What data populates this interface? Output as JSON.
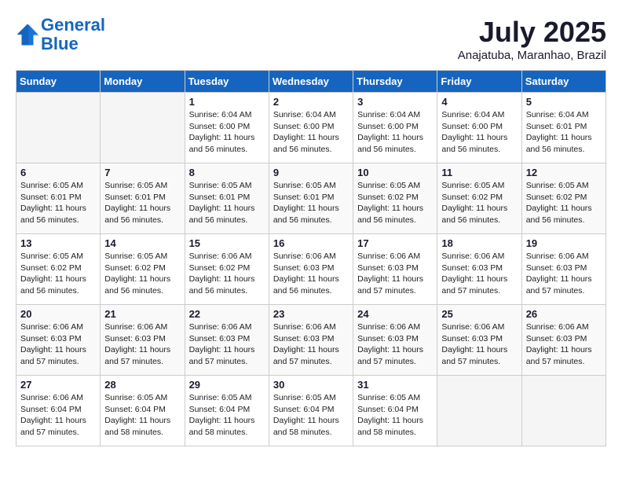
{
  "header": {
    "logo_line1": "General",
    "logo_line2": "Blue",
    "month_title": "July 2025",
    "location": "Anajatuba, Maranhao, Brazil"
  },
  "weekdays": [
    "Sunday",
    "Monday",
    "Tuesday",
    "Wednesday",
    "Thursday",
    "Friday",
    "Saturday"
  ],
  "weeks": [
    [
      {
        "day": "",
        "info": ""
      },
      {
        "day": "",
        "info": ""
      },
      {
        "day": "1",
        "info": "Sunrise: 6:04 AM\nSunset: 6:00 PM\nDaylight: 11 hours and 56 minutes."
      },
      {
        "day": "2",
        "info": "Sunrise: 6:04 AM\nSunset: 6:00 PM\nDaylight: 11 hours and 56 minutes."
      },
      {
        "day": "3",
        "info": "Sunrise: 6:04 AM\nSunset: 6:00 PM\nDaylight: 11 hours and 56 minutes."
      },
      {
        "day": "4",
        "info": "Sunrise: 6:04 AM\nSunset: 6:00 PM\nDaylight: 11 hours and 56 minutes."
      },
      {
        "day": "5",
        "info": "Sunrise: 6:04 AM\nSunset: 6:01 PM\nDaylight: 11 hours and 56 minutes."
      }
    ],
    [
      {
        "day": "6",
        "info": "Sunrise: 6:05 AM\nSunset: 6:01 PM\nDaylight: 11 hours and 56 minutes."
      },
      {
        "day": "7",
        "info": "Sunrise: 6:05 AM\nSunset: 6:01 PM\nDaylight: 11 hours and 56 minutes."
      },
      {
        "day": "8",
        "info": "Sunrise: 6:05 AM\nSunset: 6:01 PM\nDaylight: 11 hours and 56 minutes."
      },
      {
        "day": "9",
        "info": "Sunrise: 6:05 AM\nSunset: 6:01 PM\nDaylight: 11 hours and 56 minutes."
      },
      {
        "day": "10",
        "info": "Sunrise: 6:05 AM\nSunset: 6:02 PM\nDaylight: 11 hours and 56 minutes."
      },
      {
        "day": "11",
        "info": "Sunrise: 6:05 AM\nSunset: 6:02 PM\nDaylight: 11 hours and 56 minutes."
      },
      {
        "day": "12",
        "info": "Sunrise: 6:05 AM\nSunset: 6:02 PM\nDaylight: 11 hours and 56 minutes."
      }
    ],
    [
      {
        "day": "13",
        "info": "Sunrise: 6:05 AM\nSunset: 6:02 PM\nDaylight: 11 hours and 56 minutes."
      },
      {
        "day": "14",
        "info": "Sunrise: 6:05 AM\nSunset: 6:02 PM\nDaylight: 11 hours and 56 minutes."
      },
      {
        "day": "15",
        "info": "Sunrise: 6:06 AM\nSunset: 6:02 PM\nDaylight: 11 hours and 56 minutes."
      },
      {
        "day": "16",
        "info": "Sunrise: 6:06 AM\nSunset: 6:03 PM\nDaylight: 11 hours and 56 minutes."
      },
      {
        "day": "17",
        "info": "Sunrise: 6:06 AM\nSunset: 6:03 PM\nDaylight: 11 hours and 57 minutes."
      },
      {
        "day": "18",
        "info": "Sunrise: 6:06 AM\nSunset: 6:03 PM\nDaylight: 11 hours and 57 minutes."
      },
      {
        "day": "19",
        "info": "Sunrise: 6:06 AM\nSunset: 6:03 PM\nDaylight: 11 hours and 57 minutes."
      }
    ],
    [
      {
        "day": "20",
        "info": "Sunrise: 6:06 AM\nSunset: 6:03 PM\nDaylight: 11 hours and 57 minutes."
      },
      {
        "day": "21",
        "info": "Sunrise: 6:06 AM\nSunset: 6:03 PM\nDaylight: 11 hours and 57 minutes."
      },
      {
        "day": "22",
        "info": "Sunrise: 6:06 AM\nSunset: 6:03 PM\nDaylight: 11 hours and 57 minutes."
      },
      {
        "day": "23",
        "info": "Sunrise: 6:06 AM\nSunset: 6:03 PM\nDaylight: 11 hours and 57 minutes."
      },
      {
        "day": "24",
        "info": "Sunrise: 6:06 AM\nSunset: 6:03 PM\nDaylight: 11 hours and 57 minutes."
      },
      {
        "day": "25",
        "info": "Sunrise: 6:06 AM\nSunset: 6:03 PM\nDaylight: 11 hours and 57 minutes."
      },
      {
        "day": "26",
        "info": "Sunrise: 6:06 AM\nSunset: 6:03 PM\nDaylight: 11 hours and 57 minutes."
      }
    ],
    [
      {
        "day": "27",
        "info": "Sunrise: 6:06 AM\nSunset: 6:04 PM\nDaylight: 11 hours and 57 minutes."
      },
      {
        "day": "28",
        "info": "Sunrise: 6:05 AM\nSunset: 6:04 PM\nDaylight: 11 hours and 58 minutes."
      },
      {
        "day": "29",
        "info": "Sunrise: 6:05 AM\nSunset: 6:04 PM\nDaylight: 11 hours and 58 minutes."
      },
      {
        "day": "30",
        "info": "Sunrise: 6:05 AM\nSunset: 6:04 PM\nDaylight: 11 hours and 58 minutes."
      },
      {
        "day": "31",
        "info": "Sunrise: 6:05 AM\nSunset: 6:04 PM\nDaylight: 11 hours and 58 minutes."
      },
      {
        "day": "",
        "info": ""
      },
      {
        "day": "",
        "info": ""
      }
    ]
  ]
}
